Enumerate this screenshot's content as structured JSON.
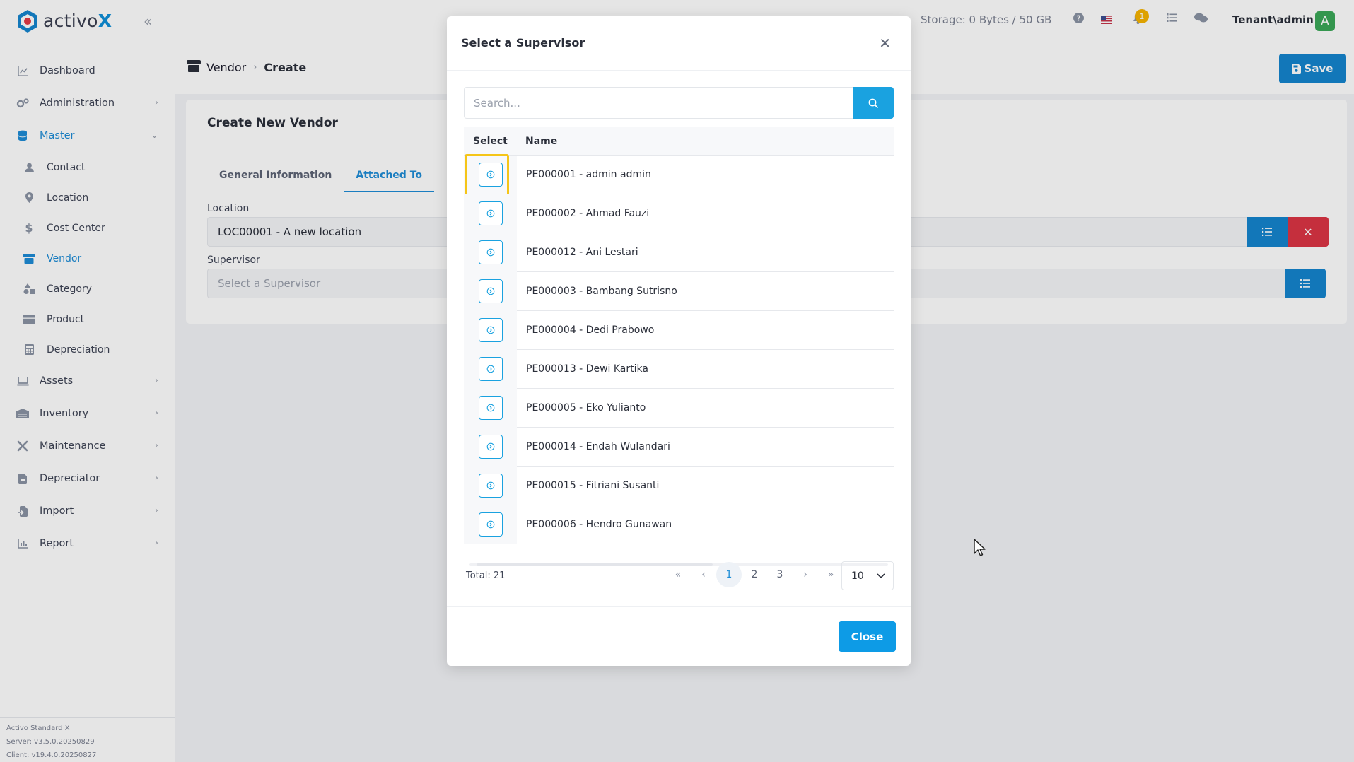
{
  "brand": {
    "name_main": "activo",
    "name_x": "X",
    "accent": "#1585cf"
  },
  "sidebar": {
    "items": [
      {
        "label": "Dashboard",
        "icon": "chart-line-icon",
        "has_children": false
      },
      {
        "label": "Administration",
        "icon": "gears-icon",
        "has_children": true
      },
      {
        "label": "Master",
        "icon": "database-icon",
        "has_children": true,
        "expanded": true,
        "active": true
      },
      {
        "label": "Assets",
        "icon": "laptop-icon",
        "has_children": true
      },
      {
        "label": "Inventory",
        "icon": "warehouse-icon",
        "has_children": true
      },
      {
        "label": "Maintenance",
        "icon": "tools-icon",
        "has_children": true
      },
      {
        "label": "Depreciator",
        "icon": "file-invoice-icon",
        "has_children": true
      },
      {
        "label": "Import",
        "icon": "file-import-icon",
        "has_children": true
      },
      {
        "label": "Report",
        "icon": "chart-bar-icon",
        "has_children": true
      }
    ],
    "sub_items": [
      {
        "label": "Contact",
        "icon": "user-icon"
      },
      {
        "label": "Location",
        "icon": "map-pin-icon"
      },
      {
        "label": "Cost Center",
        "icon": "dollar-icon"
      },
      {
        "label": "Vendor",
        "icon": "store-icon",
        "active": true
      },
      {
        "label": "Category",
        "icon": "shapes-icon"
      },
      {
        "label": "Product",
        "icon": "box-icon"
      },
      {
        "label": "Depreciation",
        "icon": "calculator-icon"
      }
    ],
    "footer": {
      "line1": "Activo Standard X",
      "line2": "Server: v3.5.0.20250829",
      "line3": "Client: v19.4.0.20250827"
    }
  },
  "topbar": {
    "storage": "Storage: 0 Bytes / 50 GB",
    "notification_count": "1",
    "tenant": "Tenant\\admin",
    "avatar_letter": "A",
    "avatar_color": "#3aa757"
  },
  "header": {
    "breadcrumb_root": "Vendor",
    "breadcrumb_current": "Create",
    "save_label": "Save"
  },
  "form": {
    "title": "Create New Vendor",
    "tabs": [
      "General Information",
      "Attached To"
    ],
    "active_tab": "Attached To",
    "location_label": "Location",
    "location_value": "LOC00001 - A new location",
    "supervisor_label": "Supervisor",
    "supervisor_placeholder": "Select a Supervisor"
  },
  "modal": {
    "title": "Select a Supervisor",
    "search_placeholder": "Search...",
    "col_select": "Select",
    "col_name": "Name",
    "rows": [
      "PE000001 - admin admin",
      "PE000002 - Ahmad Fauzi",
      "PE000012 - Ani Lestari",
      "PE000003 - Bambang Sutrisno",
      "PE000004 - Dedi Prabowo",
      "PE000013 - Dewi Kartika",
      "PE000005 - Eko Yulianto",
      "PE000014 - Endah Wulandari",
      "PE000015 - Fitriani Susanti",
      "PE000006 - Hendro Gunawan"
    ],
    "total": "Total: 21",
    "pages": [
      "1",
      "2",
      "3"
    ],
    "current_page": "1",
    "page_size": "10",
    "close_label": "Close"
  }
}
